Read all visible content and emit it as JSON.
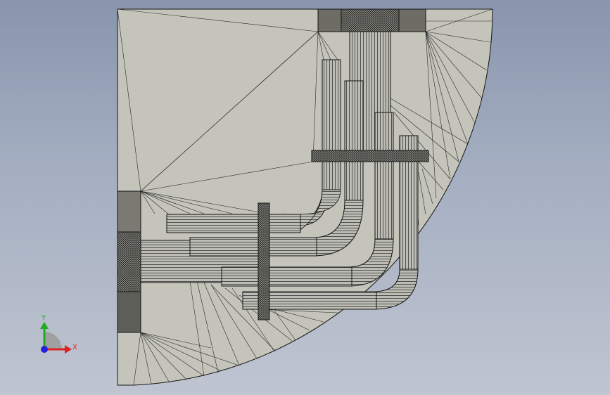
{
  "viewport": {
    "background_top": "#8895ad",
    "background_bottom": "#bfc5d1"
  },
  "model": {
    "face_color": "#c4c4bb",
    "edge_color": "#141414",
    "dark_face_color": "#707068"
  },
  "triad": {
    "y_label": "Y",
    "x_label": "X",
    "y_color": "#22aa22",
    "x_color": "#dd2222",
    "z_color": "#2222dd"
  }
}
